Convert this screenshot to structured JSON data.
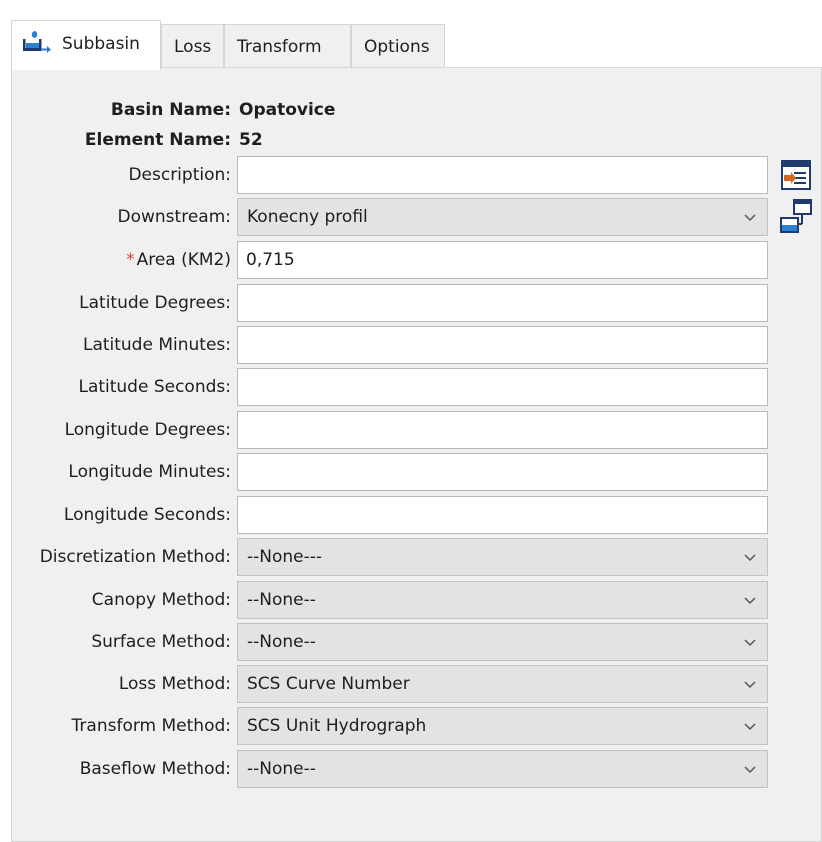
{
  "tabs": [
    {
      "label": "Subbasin",
      "icon": "subbasin-icon",
      "active": true
    },
    {
      "label": "Loss",
      "active": false
    },
    {
      "label": "Transform",
      "active": false
    },
    {
      "label": "Options",
      "active": false
    }
  ],
  "header": {
    "basin_name_label": "Basin Name:",
    "basin_name_value": "Opatovice",
    "element_name_label": "Element Name:",
    "element_name_value": "52"
  },
  "fields": {
    "description": {
      "label": "Description:",
      "value": ""
    },
    "downstream": {
      "label": "Downstream:",
      "value": "Konecny profil"
    },
    "area": {
      "required_mark": "*",
      "label": "Area (KM2)",
      "value": "0,715"
    },
    "lat_deg": {
      "label": "Latitude Degrees:",
      "value": ""
    },
    "lat_min": {
      "label": "Latitude Minutes:",
      "value": ""
    },
    "lat_sec": {
      "label": "Latitude Seconds:",
      "value": ""
    },
    "lon_deg": {
      "label": "Longitude Degrees:",
      "value": ""
    },
    "lon_min": {
      "label": "Longitude Minutes:",
      "value": ""
    },
    "lon_sec": {
      "label": "Longitude Seconds:",
      "value": ""
    },
    "discretization": {
      "label": "Discretization Method:",
      "value": "--None---"
    },
    "canopy": {
      "label": "Canopy Method:",
      "value": "--None--"
    },
    "surface": {
      "label": "Surface Method:",
      "value": "--None--"
    },
    "loss": {
      "label": "Loss Method:",
      "value": "SCS Curve Number"
    },
    "transform": {
      "label": "Transform Method:",
      "value": "SCS Unit Hydrograph"
    },
    "baseflow": {
      "label": "Baseflow Method:",
      "value": "--None--"
    }
  },
  "side_buttons": {
    "description_editor_icon": "edit-description-icon",
    "select_downstream_icon": "select-element-icon"
  },
  "colors": {
    "required": "#e23b3b",
    "tab_border": "#d5d5d5",
    "panel_bg": "#f0f0f0",
    "combo_bg": "#e3e3e3",
    "icon_navy": "#1f3b6e",
    "icon_blue": "#2d7fd3",
    "icon_orange": "#d2691e"
  }
}
